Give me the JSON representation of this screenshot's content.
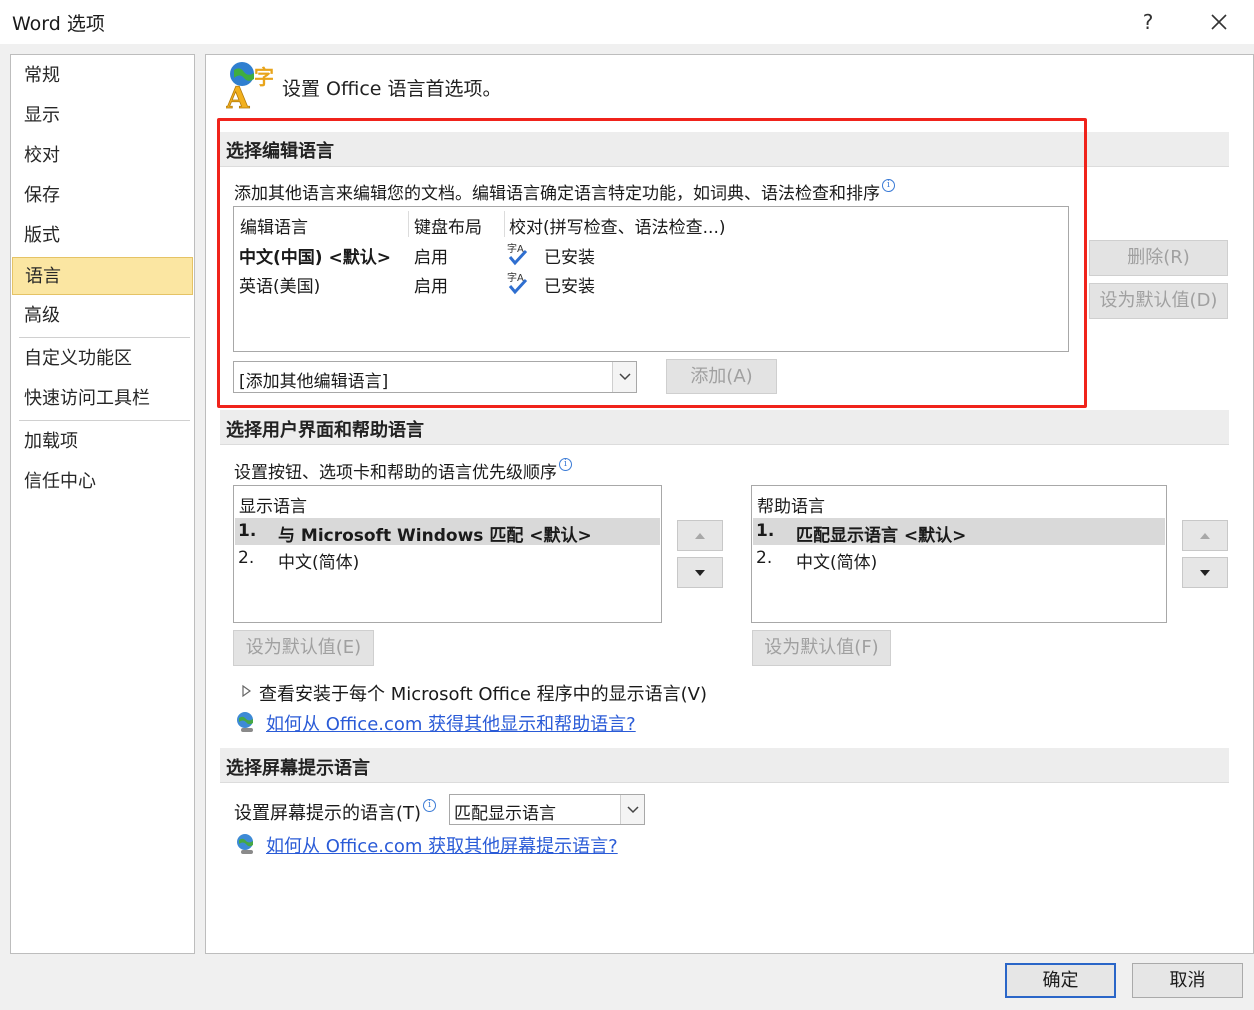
{
  "window": {
    "title": "Word 选项",
    "help": "?"
  },
  "nav": {
    "items": [
      "常规",
      "显示",
      "校对",
      "保存",
      "版式",
      "语言",
      "高级",
      "自定义功能区",
      "快速访问工具栏",
      "加载项",
      "信任中心"
    ],
    "selected": "语言"
  },
  "header": {
    "text": "设置 Office 语言首选项。"
  },
  "editing": {
    "title": "选择编辑语言",
    "description": "添加其他语言来编辑您的文档。编辑语言确定语言特定功能，如词典、语法检查和排序",
    "columns": [
      "编辑语言",
      "键盘布局",
      "校对(拼写检查、语法检查...)"
    ],
    "rows": [
      {
        "language": "中文(中国) <默认>",
        "keyboard": "启用",
        "proofing": "已安装",
        "bold": true
      },
      {
        "language": "英语(美国)",
        "keyboard": "启用",
        "proofing": "已安装",
        "bold": false
      }
    ],
    "add_combo_value": "[添加其他编辑语言]",
    "add_button": "添加(A)",
    "remove_button": "删除(R)",
    "set_default_button": "设为默认值(D)"
  },
  "ui_language": {
    "title": "选择用户界面和帮助语言",
    "description": "设置按钮、选项卡和帮助的语言优先级顺序",
    "display": {
      "header": "显示语言",
      "items": [
        {
          "num": "1.",
          "label": "与 Microsoft Windows 匹配 <默认>"
        },
        {
          "num": "2.",
          "label": "中文(简体)"
        }
      ],
      "set_default_button": "设为默认值(E)"
    },
    "help": {
      "header": "帮助语言",
      "items": [
        {
          "num": "1.",
          "label": "匹配显示语言 <默认>"
        },
        {
          "num": "2.",
          "label": "中文(简体)"
        }
      ],
      "set_default_button": "设为默认值(F)"
    },
    "expand_text": "查看安装于每个 Microsoft Office 程序中的显示语言(V)",
    "link": "如何从 Office.com 获得其他显示和帮助语言?"
  },
  "screentip": {
    "title": "选择屏幕提示语言",
    "label": "设置屏幕提示的语言(T)",
    "combo_value": "匹配显示语言",
    "link": "如何从 Office.com 获取其他屏幕提示语言?"
  },
  "footer": {
    "ok": "确定",
    "cancel": "取消"
  },
  "colors": {
    "highlight_border": "#f0231b",
    "nav_selected": "#fbe6a2",
    "link": "#2a5bd7",
    "primary_border": "#2a66c8"
  }
}
